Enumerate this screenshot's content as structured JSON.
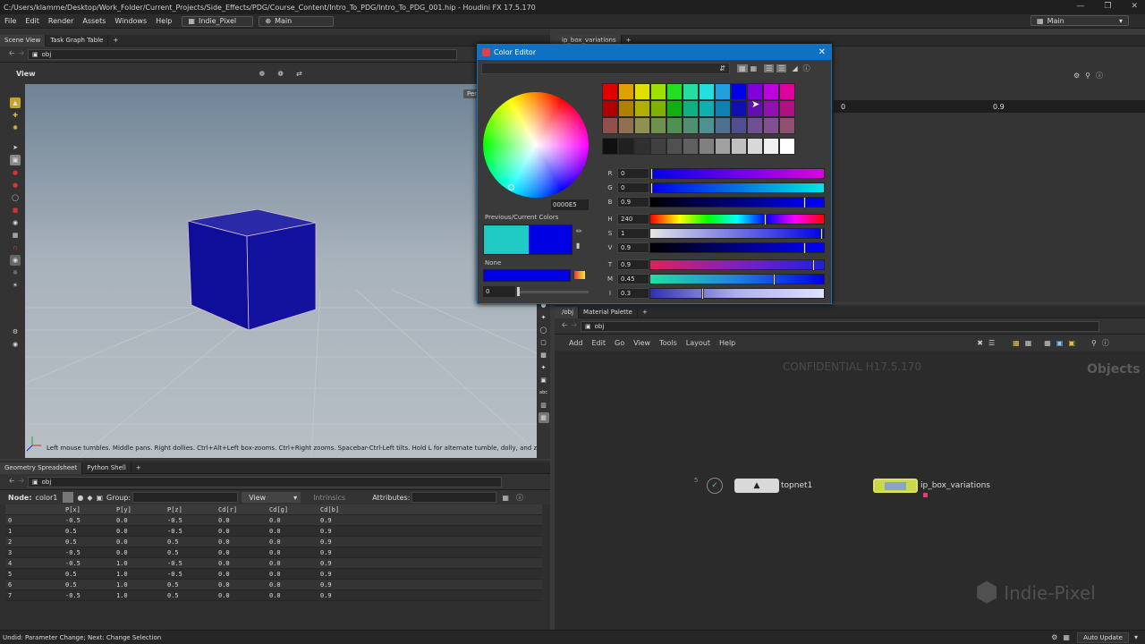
{
  "window": {
    "title": "C:/Users/klamme/Desktop/Work_Folder/Current_Projects/Side_Effects/PDG/Course_Content/Intro_To_PDG/Intro_To_PDG_001.hip - Houdini FX 17.5.170"
  },
  "menu": {
    "items": [
      "File",
      "Edit",
      "Render",
      "Assets",
      "Windows",
      "Help"
    ],
    "desk": "Indie_Pixel",
    "desktop": "Main",
    "right_desktop": "Main"
  },
  "scene_view": {
    "tabs": [
      "Scene View",
      "Task Graph Table"
    ],
    "path": "obj",
    "view_label": "View",
    "persp": "Pers",
    "hint": "Left mouse tumbles. Middle pans. Right dollies. Ctrl+Alt+Left box-zooms. Ctrl+Right zooms. Spacebar-Ctrl-Left tilts. Hold L for alternate tumble, dolly, and zoom."
  },
  "right_top": {
    "tab": "ip_box_variations",
    "value1": "0",
    "value2": "0.9"
  },
  "color_editor": {
    "title": "Color Editor",
    "hex": "0000E5",
    "prev_label": "Previous/Current Colors",
    "prev_color": "#1fc9c4",
    "current_color": "#0000e5",
    "none_label": "None",
    "none_value": "0",
    "palette": [
      [
        "#e00000",
        "#e0a000",
        "#e0e000",
        "#a0e000",
        "#20e020",
        "#20e0a0",
        "#20e0e0",
        "#20a0e0",
        "#0000e5",
        "#8000e0",
        "#c000e0",
        "#e000a0"
      ],
      [
        "#b00000",
        "#b08000",
        "#b0b000",
        "#80b000",
        "#10b010",
        "#10b080",
        "#10b0b0",
        "#1080b0",
        "#1010b0",
        "#6010b0",
        "#9010b0",
        "#b01080"
      ],
      [
        "#905050",
        "#907050",
        "#909050",
        "#709050",
        "#509050",
        "#509070",
        "#509090",
        "#507090",
        "#505090",
        "#705090",
        "#805090",
        "#905070"
      ],
      [
        "#101010",
        "#202020",
        "#303030",
        "#404040",
        "#505050",
        "#606060",
        "#808080",
        "#a0a0a0",
        "#c0c0c0",
        "#d8d8d8",
        "#f0f0f0",
        "#ffffff"
      ]
    ],
    "sliders": [
      {
        "label": "R",
        "value": "0",
        "pos": 0.0,
        "bg": "linear-gradient(90deg,#0000e5,#e000e5)"
      },
      {
        "label": "G",
        "value": "0",
        "pos": 0.0,
        "bg": "linear-gradient(90deg,#0000e5,#00e5e5)"
      },
      {
        "label": "B",
        "value": "0.9",
        "pos": 0.9,
        "bg": "linear-gradient(90deg,#000000,#0000ff)"
      },
      {
        "label": "H",
        "value": "240",
        "pos": 0.667,
        "bg": "linear-gradient(90deg,#ff0000,#ffff00,#00ff00,#00ffff,#0000ff,#ff00ff,#ff0000)"
      },
      {
        "label": "S",
        "value": "1",
        "pos": 1.0,
        "bg": "linear-gradient(90deg,#e5e5e5,#0000e5)"
      },
      {
        "label": "V",
        "value": "0.9",
        "pos": 0.9,
        "bg": "linear-gradient(90deg,#000000,#0000ff)"
      },
      {
        "label": "T",
        "value": "0.9",
        "pos": 0.95,
        "bg": "linear-gradient(90deg,#e0205a,#8020c0,#2020e0)"
      },
      {
        "label": "M",
        "value": "0.45",
        "pos": 0.72,
        "bg": "linear-gradient(90deg,#20e0a0,#2080e0,#0000e5)"
      },
      {
        "label": "I",
        "value": "0.3",
        "pos": 0.3,
        "bg": "linear-gradient(90deg,#3030b0,#b0b0f0,#e0e0ff)"
      }
    ]
  },
  "spreadsheet": {
    "tabs": [
      "Geometry Spreadsheet",
      "Python Shell"
    ],
    "path": "obj",
    "node_label": "Node:",
    "node_name": "color1",
    "group_label": "Group:",
    "view_label": "View",
    "intrinsics_label": "Intrinsics",
    "attributes_label": "Attributes:",
    "columns": [
      "",
      "P[x]",
      "P[y]",
      "P[z]",
      "Cd[r]",
      "Cd[g]",
      "Cd[b]"
    ],
    "rows": [
      [
        "0",
        "-0.5",
        "0.0",
        "-0.5",
        "0.0",
        "0.0",
        "0.9"
      ],
      [
        "1",
        "0.5",
        "0.0",
        "-0.5",
        "0.0",
        "0.0",
        "0.9"
      ],
      [
        "2",
        "0.5",
        "0.0",
        "0.5",
        "0.0",
        "0.0",
        "0.9"
      ],
      [
        "3",
        "-0.5",
        "0.0",
        "0.5",
        "0.0",
        "0.0",
        "0.9"
      ],
      [
        "4",
        "-0.5",
        "1.0",
        "-0.5",
        "0.0",
        "0.0",
        "0.9"
      ],
      [
        "5",
        "0.5",
        "1.0",
        "-0.5",
        "0.0",
        "0.0",
        "0.9"
      ],
      [
        "6",
        "0.5",
        "1.0",
        "0.5",
        "0.0",
        "0.0",
        "0.9"
      ],
      [
        "7",
        "-0.5",
        "1.0",
        "0.5",
        "0.0",
        "0.0",
        "0.9"
      ]
    ]
  },
  "network": {
    "tabs": [
      "/obj",
      "Material Palette"
    ],
    "path": "obj",
    "menu": [
      "Add",
      "Edit",
      "Go",
      "View",
      "Tools",
      "Layout",
      "Help"
    ],
    "watermark": "CONFIDENTIAL H17.5.170",
    "context": "Objects",
    "nodes": [
      {
        "name": "topnet1",
        "badge": "5"
      },
      {
        "name": "ip_box_variations"
      }
    ],
    "logo_text": "Indie-Pixel"
  },
  "status": {
    "text": "Undid: Parameter Change; Next: Change Selection",
    "auto_update": "Auto Update"
  },
  "colors": {
    "accent": "#0e71c3",
    "box": "#1010a0",
    "viewport_top": "#6f8496"
  }
}
